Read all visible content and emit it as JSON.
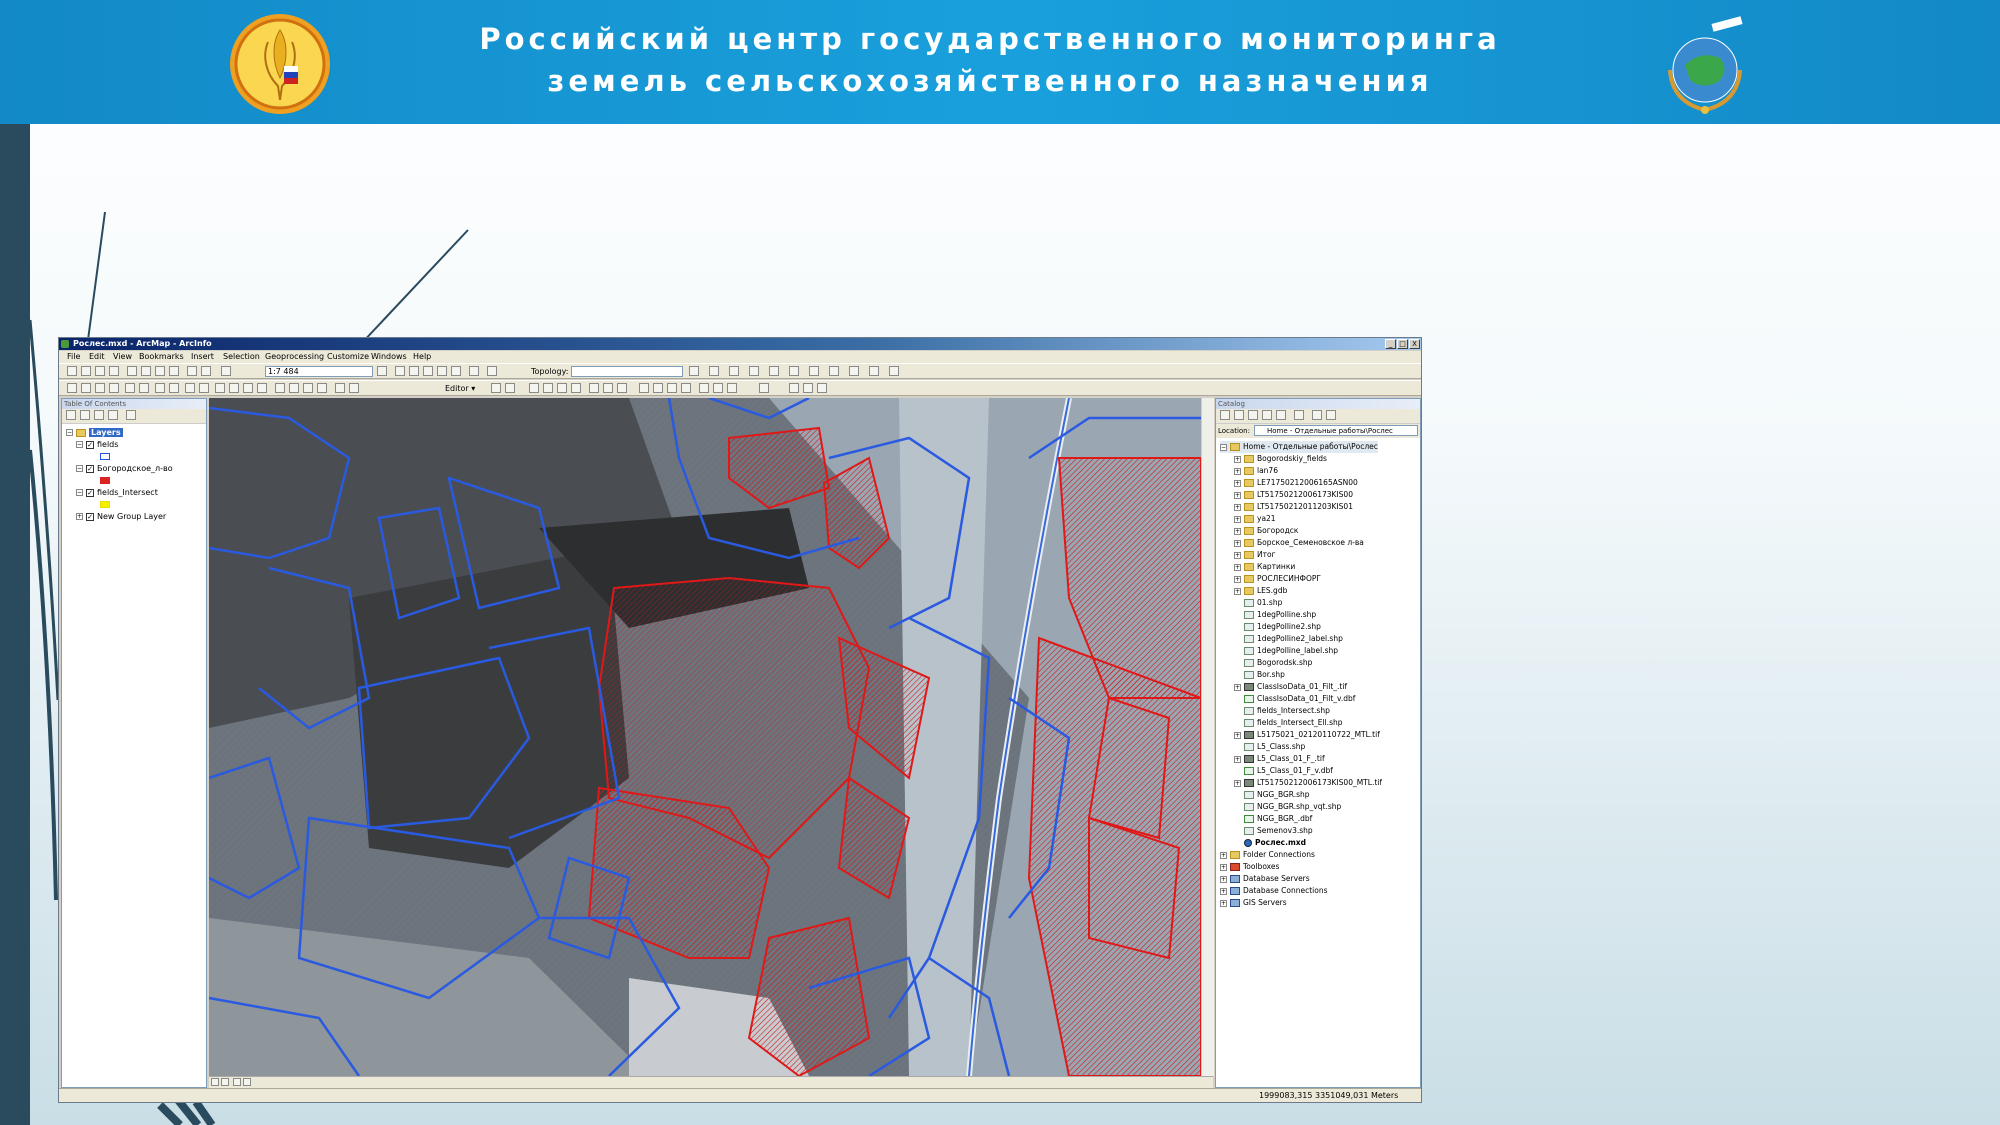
{
  "slide": {
    "title_line1": "Российский центр государственного мониторинга",
    "title_line2": "земель сельскохозяйственного назначения",
    "colors": {
      "banner": "#1a9ad6",
      "side_bar": "#2a4a5e",
      "accent_red": "#cc1a1a",
      "accent_blue": "#2255dd"
    },
    "logos": [
      "ministry-agriculture-wheat-logo",
      "globe-satellite-emblem"
    ]
  },
  "window": {
    "title": "Рослес.mxd - ArcMap - ArcInfo",
    "controls": [
      "_",
      "□",
      "X"
    ]
  },
  "menu": [
    "File",
    "Edit",
    "View",
    "Bookmarks",
    "Insert",
    "Selection",
    "Geoprocessing",
    "Customize",
    "Windows",
    "Help"
  ],
  "toolbar": {
    "scale": "1:7 484",
    "topology_label": "Topology:",
    "editor_label": "Editor ▾"
  },
  "toc": {
    "title": "Table Of Contents",
    "root": "Layers",
    "layers": [
      {
        "name": "fields",
        "checked": true,
        "symbol_color": "#2255dd"
      },
      {
        "name": "Богородское_л-во",
        "checked": true,
        "symbol_color": "#dd2222"
      },
      {
        "name": "fields_Intersect",
        "checked": true,
        "symbol_color": "#e8e000"
      },
      {
        "name": "New Group Layer",
        "checked": true,
        "symbol_color": ""
      }
    ]
  },
  "catalog": {
    "title": "Catalog",
    "location_label": "Location:",
    "location_value": "Home - Отдельные работы\\Рослес",
    "home": "Home - Отдельные работы\\Рослес",
    "items": [
      {
        "name": "Bogorodskiy_fields",
        "type": "folder"
      },
      {
        "name": "lan76",
        "type": "folder"
      },
      {
        "name": "LE71750212006165ASN00",
        "type": "folder"
      },
      {
        "name": "LT51750212006173KIS00",
        "type": "folder"
      },
      {
        "name": "LT51750212011203KIS01",
        "type": "folder"
      },
      {
        "name": "ya21",
        "type": "folder"
      },
      {
        "name": "Богородск",
        "type": "folder"
      },
      {
        "name": "Борское_Семеновское л-ва",
        "type": "folder"
      },
      {
        "name": "Итог",
        "type": "folder"
      },
      {
        "name": "Картинки",
        "type": "folder"
      },
      {
        "name": "РОСЛЕСИНФОРГ",
        "type": "folder"
      },
      {
        "name": "LES.gdb",
        "type": "gdb"
      },
      {
        "name": "01.shp",
        "type": "file"
      },
      {
        "name": "1degPolline.shp",
        "type": "file"
      },
      {
        "name": "1degPolline2.shp",
        "type": "file"
      },
      {
        "name": "1degPolline2_label.shp",
        "type": "file"
      },
      {
        "name": "1degPolline_label.shp",
        "type": "file"
      },
      {
        "name": "Bogorodsk.shp",
        "type": "file"
      },
      {
        "name": "Bor.shp",
        "type": "file"
      },
      {
        "name": "ClassIsoData_01_Filt_.tif",
        "type": "raster"
      },
      {
        "name": "ClassIsoData_01_Filt_v.dbf",
        "type": "table"
      },
      {
        "name": "fields_Intersect.shp",
        "type": "file"
      },
      {
        "name": "fields_Intersect_Ell.shp",
        "type": "file"
      },
      {
        "name": "L5175021_02120110722_MTL.tif",
        "type": "raster"
      },
      {
        "name": "L5_Class.shp",
        "type": "file"
      },
      {
        "name": "L5_Class_01_F_.tif",
        "type": "raster"
      },
      {
        "name": "L5_Class_01_F_v.dbf",
        "type": "table"
      },
      {
        "name": "LT51750212006173KIS00_MTL.tif",
        "type": "raster"
      },
      {
        "name": "NGG_BGR.shp",
        "type": "file"
      },
      {
        "name": "NGG_BGR.shp_vqt.shp",
        "type": "file"
      },
      {
        "name": "NGG_BGR_.dbf",
        "type": "table"
      },
      {
        "name": "Semenov3.shp",
        "type": "file"
      },
      {
        "name": "Рослес.mxd",
        "type": "mxd"
      }
    ],
    "connections": [
      {
        "name": "Folder Connections",
        "type": "folder"
      },
      {
        "name": "Toolboxes",
        "type": "toolbox"
      },
      {
        "name": "Database Servers",
        "type": "conn"
      },
      {
        "name": "Database Connections",
        "type": "conn"
      },
      {
        "name": "GIS Servers",
        "type": "conn"
      }
    ]
  },
  "status": {
    "coordinates": "1999083,315  3351049,031 Meters"
  }
}
